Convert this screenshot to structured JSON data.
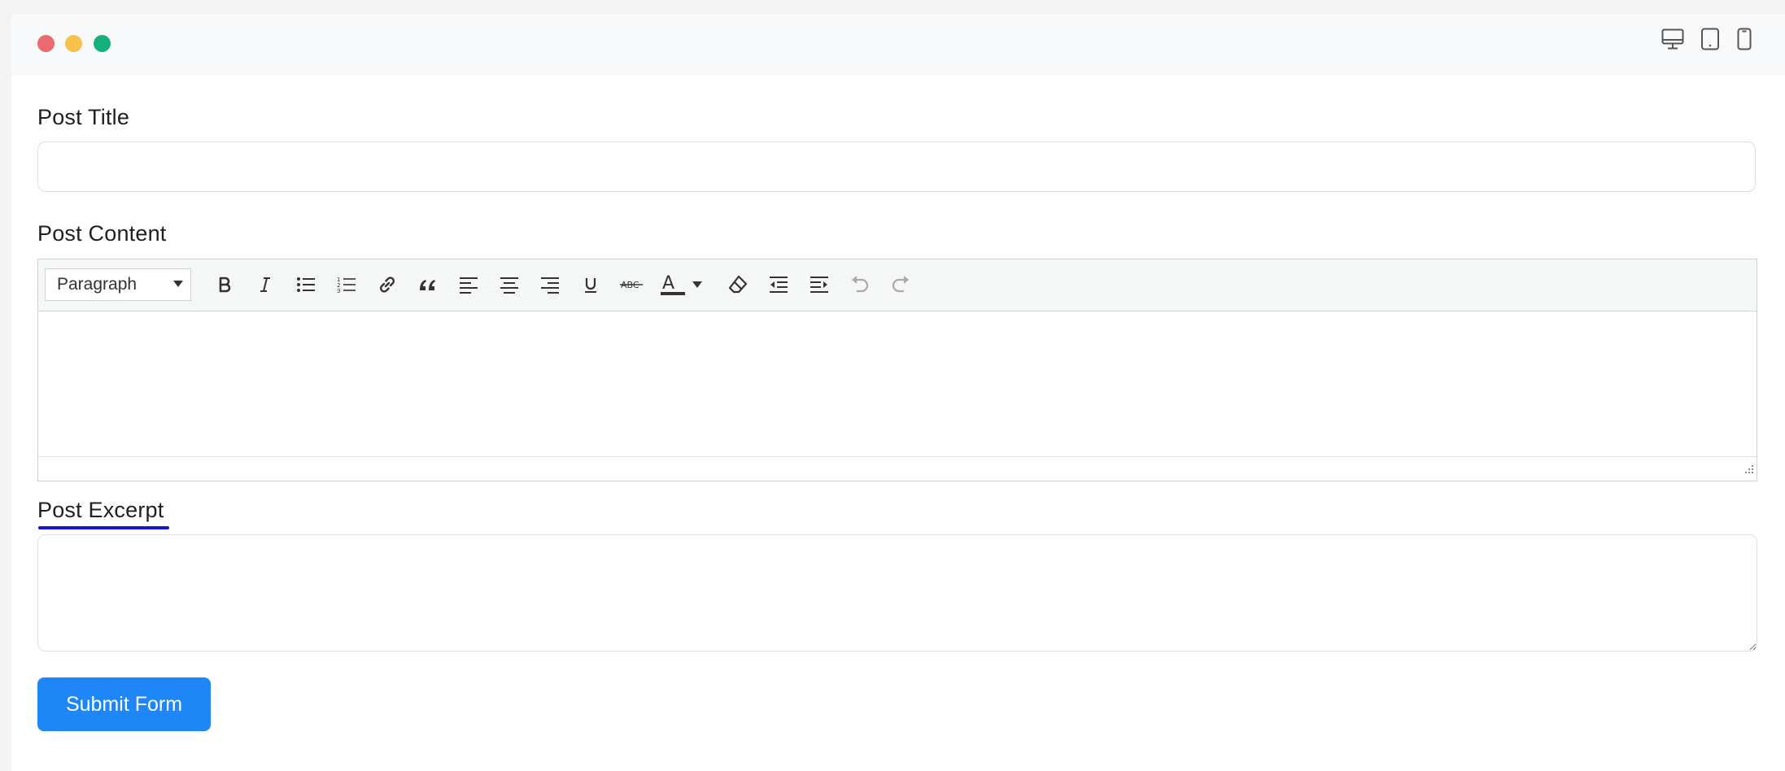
{
  "window": {
    "controls": [
      "close",
      "minimize",
      "maximize"
    ],
    "device_icons": [
      "desktop-icon",
      "tablet-icon",
      "mobile-icon"
    ]
  },
  "form": {
    "title_label": "Post Title",
    "title_value": "",
    "content_label": "Post Content",
    "excerpt_label": "Post Excerpt",
    "excerpt_value": "",
    "submit_label": "Submit Form"
  },
  "editor": {
    "block_format": "Paragraph",
    "text_color_icon_letter": "A",
    "strikethrough_icon_text": "ABC",
    "toolbar_icons": [
      "bold-icon",
      "italic-icon",
      "bullet-list-icon",
      "numbered-list-icon",
      "link-icon",
      "blockquote-icon",
      "align-left-icon",
      "align-center-icon",
      "align-right-icon",
      "underline-icon",
      "strikethrough-icon",
      "text-color-icon",
      "clear-formatting-icon",
      "outdent-icon",
      "indent-icon",
      "undo-icon",
      "redo-icon"
    ]
  },
  "colors": {
    "accent": "#1e86f7",
    "focus_underline": "#1515cf",
    "close": "#ec6a6e",
    "minimize": "#f7c14b",
    "maximize": "#14b17a"
  }
}
